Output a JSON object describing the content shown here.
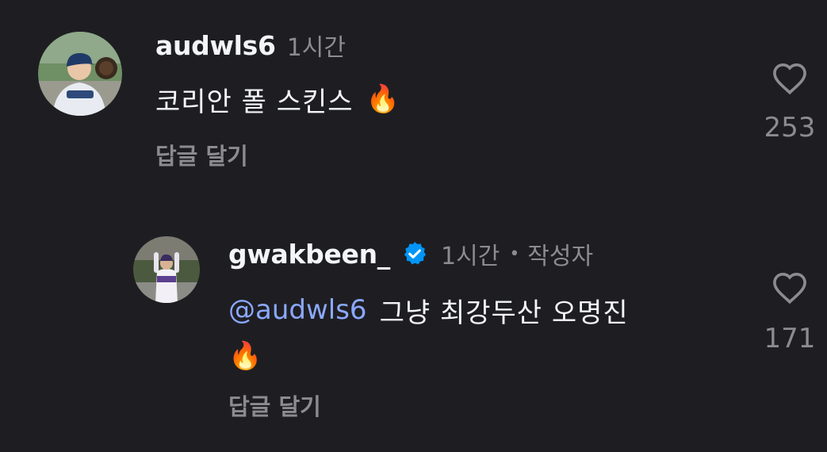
{
  "comments": [
    {
      "username": "audwls6",
      "time": "1시간",
      "text": "코리안 폴 스킨스",
      "emoji": "🔥",
      "reply_label": "답글 달기",
      "like_count": "253",
      "avatar_icon": "avatar-baseball-player-photo"
    },
    {
      "username": "gwakbeen_",
      "verified": true,
      "time": "1시간",
      "separator": "•",
      "author_badge": "작성자",
      "mention": "@audwls6",
      "text": "그냥 최강두산 오명진",
      "emoji": "🔥",
      "reply_label": "답글 달기",
      "like_count": "171",
      "avatar_icon": "avatar-baseball-player-celebrating-photo"
    }
  ],
  "colors": {
    "background": "#1e1e22",
    "primary_text": "#f3f5f7",
    "secondary_text": "#8b8b90",
    "mention": "#8ba8ff",
    "verified_badge": "#0095f6"
  }
}
